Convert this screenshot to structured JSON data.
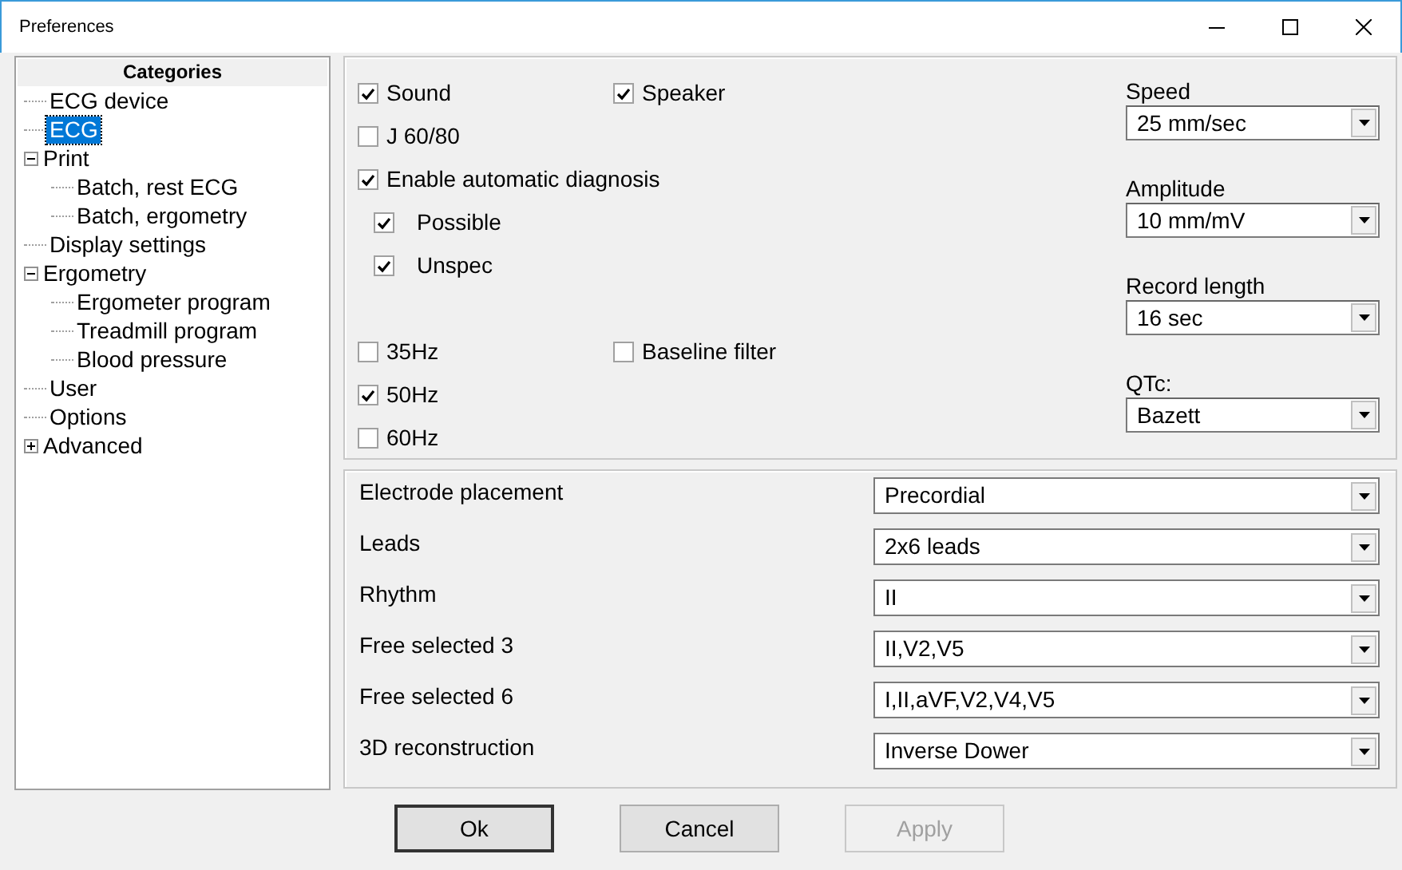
{
  "window": {
    "title": "Preferences"
  },
  "categories": {
    "header": "Categories",
    "items": [
      {
        "label": "ECG device",
        "selected": false
      },
      {
        "label": "ECG",
        "selected": true
      },
      {
        "label": "Print",
        "selected": false,
        "expanded": true,
        "children": [
          {
            "label": "Batch, rest ECG",
            "selected": false
          },
          {
            "label": "Batch, ergometry",
            "selected": false
          }
        ]
      },
      {
        "label": "Display settings",
        "selected": false
      },
      {
        "label": "Ergometry",
        "selected": false,
        "expanded": true,
        "children": [
          {
            "label": "Ergometer program",
            "selected": false
          },
          {
            "label": "Treadmill program",
            "selected": false
          },
          {
            "label": "Blood pressure",
            "selected": false
          }
        ]
      },
      {
        "label": "User",
        "selected": false
      },
      {
        "label": "Options",
        "selected": false
      },
      {
        "label": "Advanced",
        "selected": false,
        "expanded": false
      }
    ]
  },
  "check_groups": [
    {
      "items": [
        {
          "label": "Sound",
          "checked": true
        },
        {
          "label": "J 60/80",
          "checked": false
        },
        {
          "label": "Enable automatic diagnosis",
          "checked": true,
          "children": [
            {
              "label": "Possible",
              "checked": true
            },
            {
              "label": "Unspec",
              "checked": true
            }
          ]
        }
      ],
      "side": [
        {
          "label": "Speaker",
          "checked": true
        }
      ]
    },
    {
      "items": [
        {
          "label": "35Hz",
          "checked": false
        },
        {
          "label": "50Hz",
          "checked": true
        },
        {
          "label": "60Hz",
          "checked": false
        }
      ],
      "side": [
        {
          "label": "Baseline filter",
          "checked": false
        }
      ]
    }
  ],
  "display_selects": [
    {
      "label": "Speed",
      "value": "25 mm/sec"
    },
    {
      "label": "Amplitude",
      "value": "10 mm/mV"
    },
    {
      "label": "Record length",
      "value": "16 sec"
    },
    {
      "label": "QTc:",
      "value": "Bazett"
    }
  ],
  "lead_settings": [
    {
      "label": "Electrode placement",
      "value": "Precordial"
    },
    {
      "label": "Leads",
      "value": "2x6 leads"
    },
    {
      "label": "Rhythm",
      "value": "II"
    },
    {
      "label": "Free selected 3",
      "value": "II,V2,V5"
    },
    {
      "label": "Free selected 6",
      "value": "I,II,aVF,V2,V4,V5"
    },
    {
      "label": "3D reconstruction",
      "value": "Inverse Dower"
    }
  ],
  "buttons": [
    {
      "label": "Ok",
      "disabled": false
    },
    {
      "label": "Cancel",
      "disabled": false
    },
    {
      "label": "Apply",
      "disabled": true
    }
  ]
}
